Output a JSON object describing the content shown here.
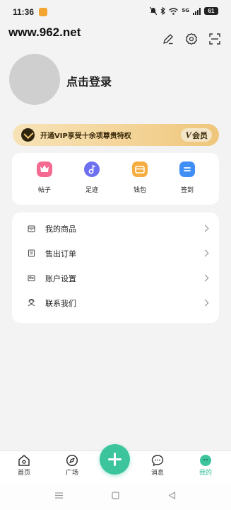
{
  "status_bar": {
    "time": "11:36",
    "network": "5G",
    "battery": "61"
  },
  "watermark": "www.962.net",
  "profile": {
    "login_text": "点击登录"
  },
  "vip": {
    "text": "开通VIP享受十余项尊贵特权",
    "badge_v": "V",
    "badge_label": "会员"
  },
  "quick_actions": [
    {
      "label": "帖子",
      "icon": "crown-icon",
      "color": "#f35b84"
    },
    {
      "label": "足迹",
      "icon": "music-note-icon",
      "color": "#6b6df0"
    },
    {
      "label": "钱包",
      "icon": "wallet-icon",
      "color": "#f3a93a"
    },
    {
      "label": "签到",
      "icon": "calendar-icon",
      "color": "#3f8ef5"
    }
  ],
  "menu": [
    {
      "label": "我的商品",
      "icon": "goods-icon"
    },
    {
      "label": "售出订单",
      "icon": "order-icon"
    },
    {
      "label": "账户设置",
      "icon": "account-icon"
    },
    {
      "label": "联系我们",
      "icon": "contact-icon"
    }
  ],
  "bottom_nav": [
    {
      "label": "首页",
      "icon": "home-icon"
    },
    {
      "label": "广场",
      "icon": "compass-icon"
    },
    {
      "label": "消息",
      "icon": "chat-icon"
    },
    {
      "label": "我的",
      "icon": "profile-face-icon",
      "active": true
    }
  ],
  "accent_color": "#3cc59d"
}
